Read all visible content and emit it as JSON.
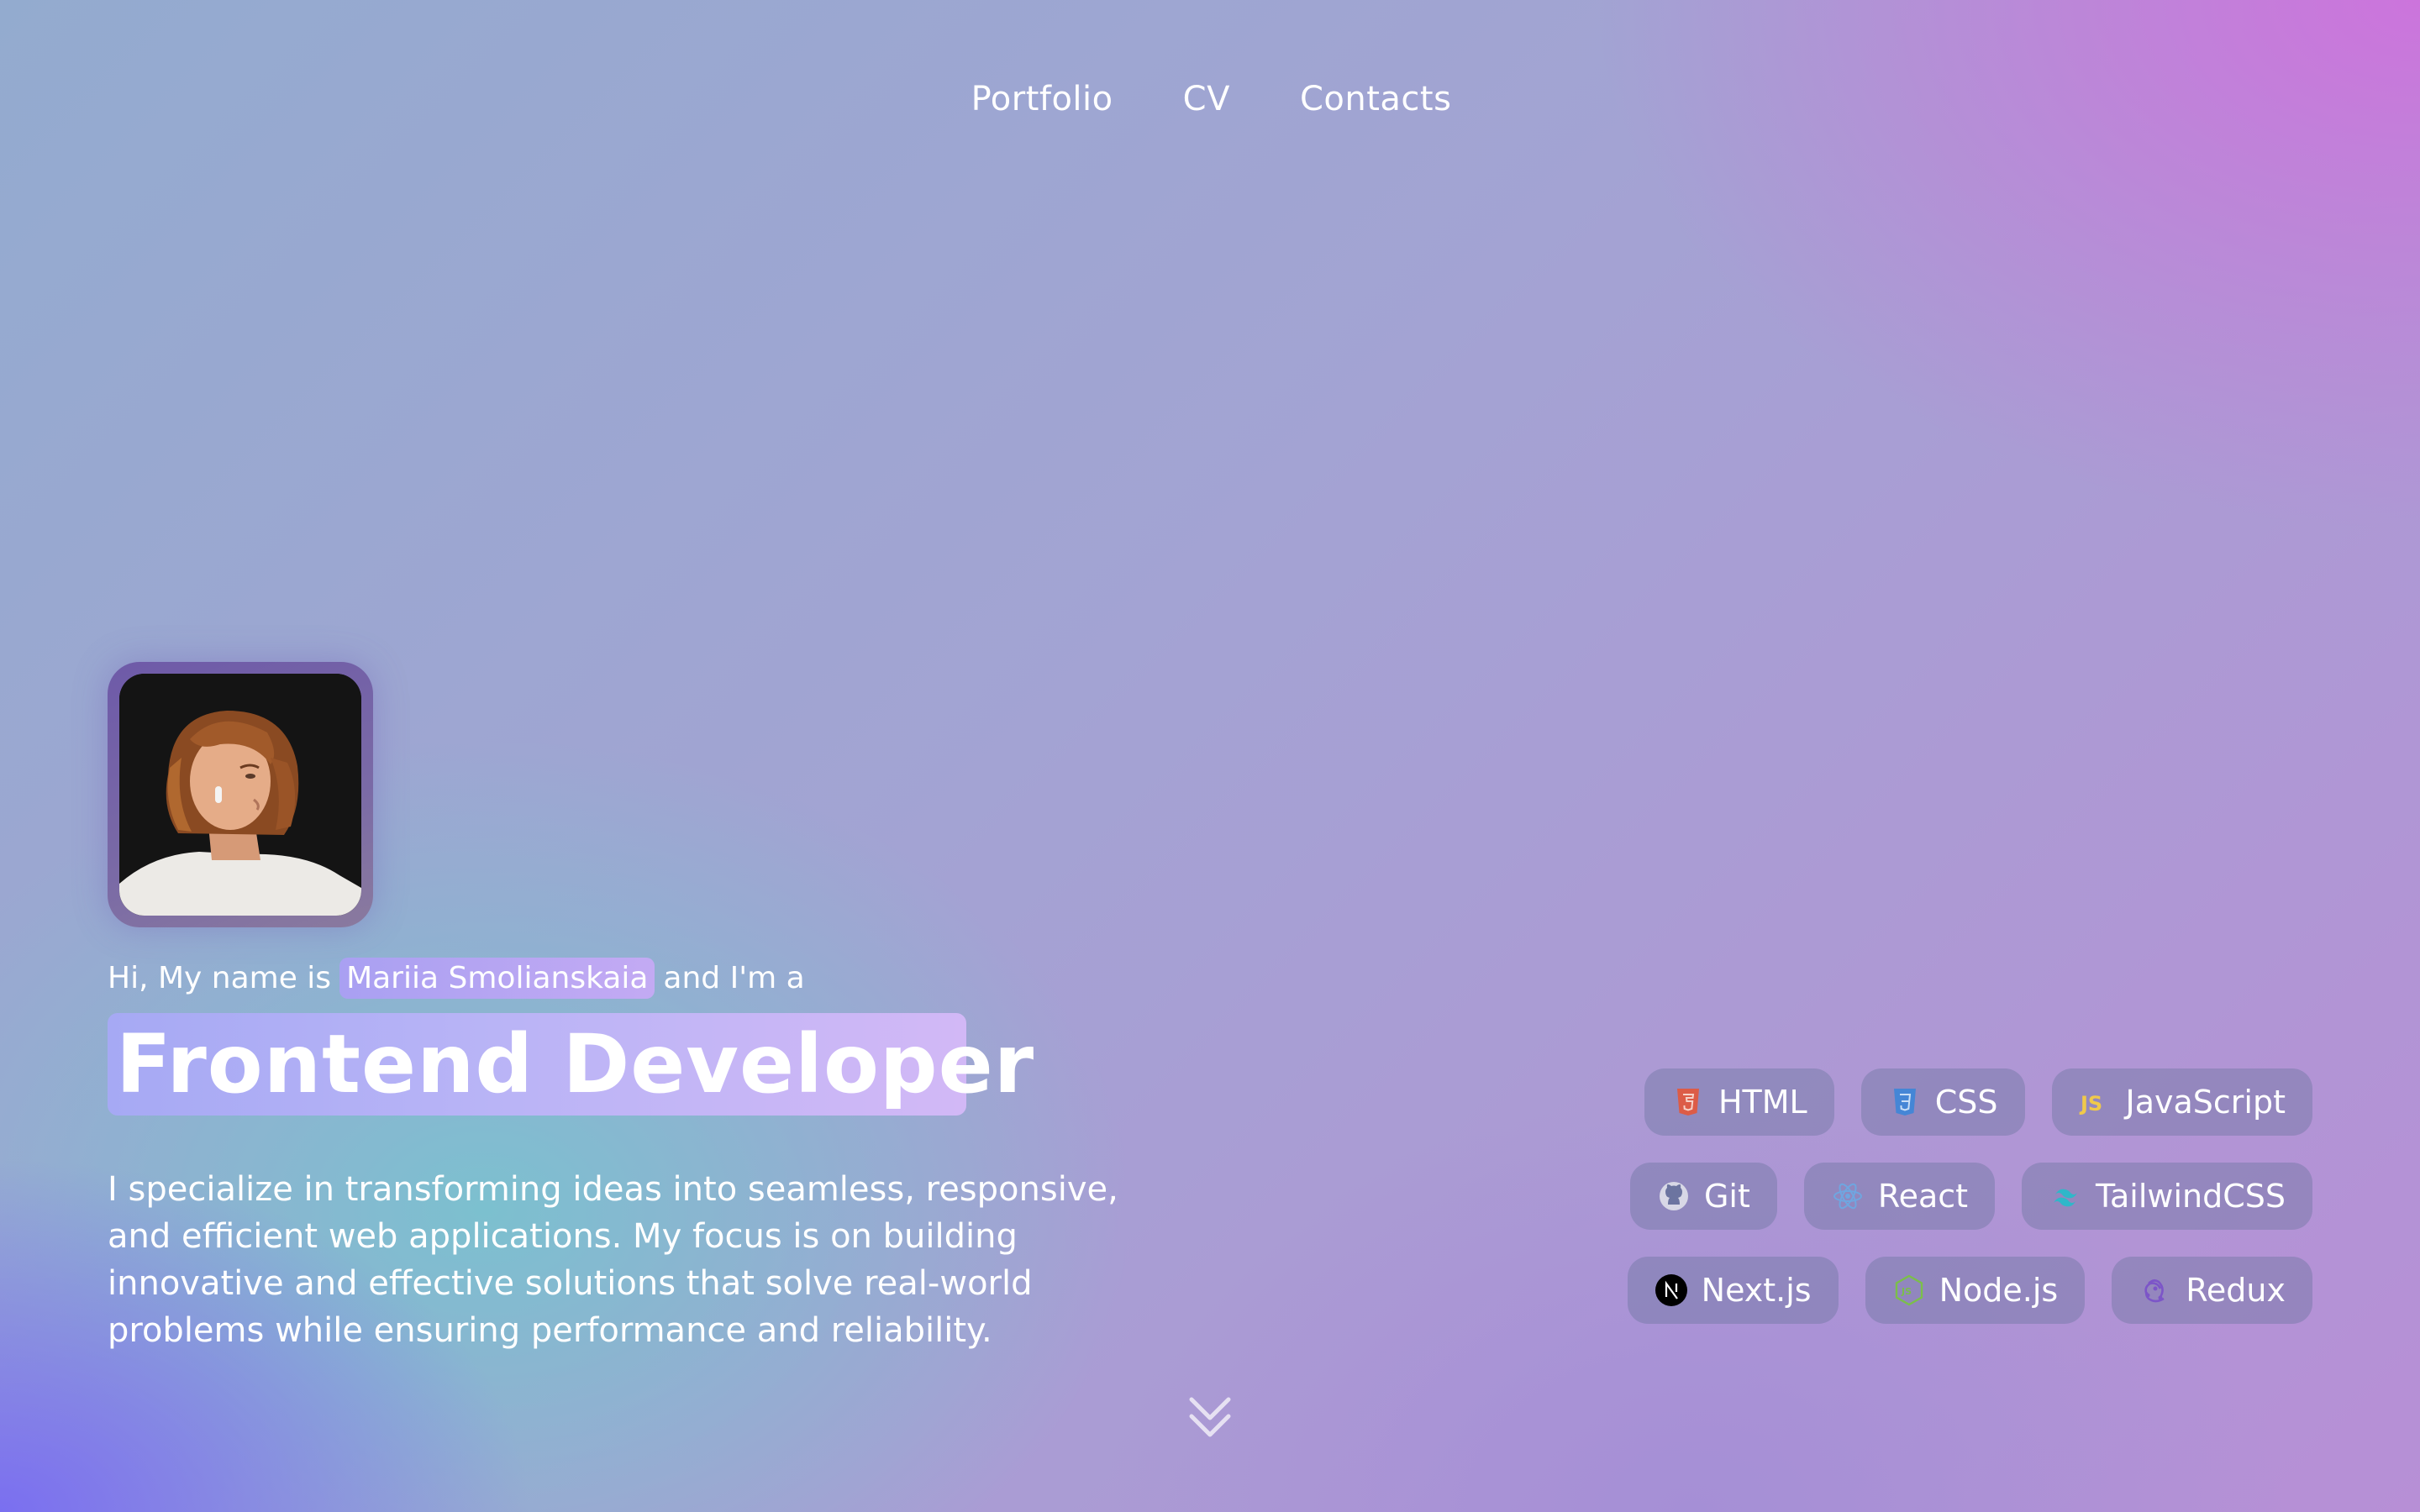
{
  "nav": {
    "items": [
      "Portfolio",
      "CV",
      "Contacts"
    ]
  },
  "hero": {
    "intro_prefix": "Hi, My name is",
    "name": "Mariia Smolianskaia",
    "intro_suffix": "and I'm a",
    "title": "Frontend Developer",
    "description": "I specialize in transforming ideas into seamless, responsive, and efficient web applications. My focus is on building innovative and effective solutions that solve real-world problems while ensuring performance and reliability."
  },
  "skills": {
    "rows": [
      [
        {
          "label": "HTML",
          "icon": "html5-icon"
        },
        {
          "label": "CSS",
          "icon": "css3-icon"
        },
        {
          "label": "JavaScript",
          "icon": "javascript-icon"
        }
      ],
      [
        {
          "label": "Git",
          "icon": "github-icon"
        },
        {
          "label": "React",
          "icon": "react-icon"
        },
        {
          "label": "TailwindCSS",
          "icon": "tailwind-icon"
        }
      ],
      [
        {
          "label": "Next.js",
          "icon": "nextjs-icon"
        },
        {
          "label": "Node.js",
          "icon": "nodejs-icon"
        },
        {
          "label": "Redux",
          "icon": "redux-icon"
        }
      ]
    ]
  },
  "scroll_indicator": {
    "icon": "chevron-double-down-icon"
  },
  "colors": {
    "html": "#e4573a",
    "css": "#3d86d8",
    "javascript": "#f0c94a",
    "react": "#6fa6e0",
    "tailwind": "#2fb7c9",
    "node": "#7bbf4a",
    "redux": "#7c55c8"
  }
}
